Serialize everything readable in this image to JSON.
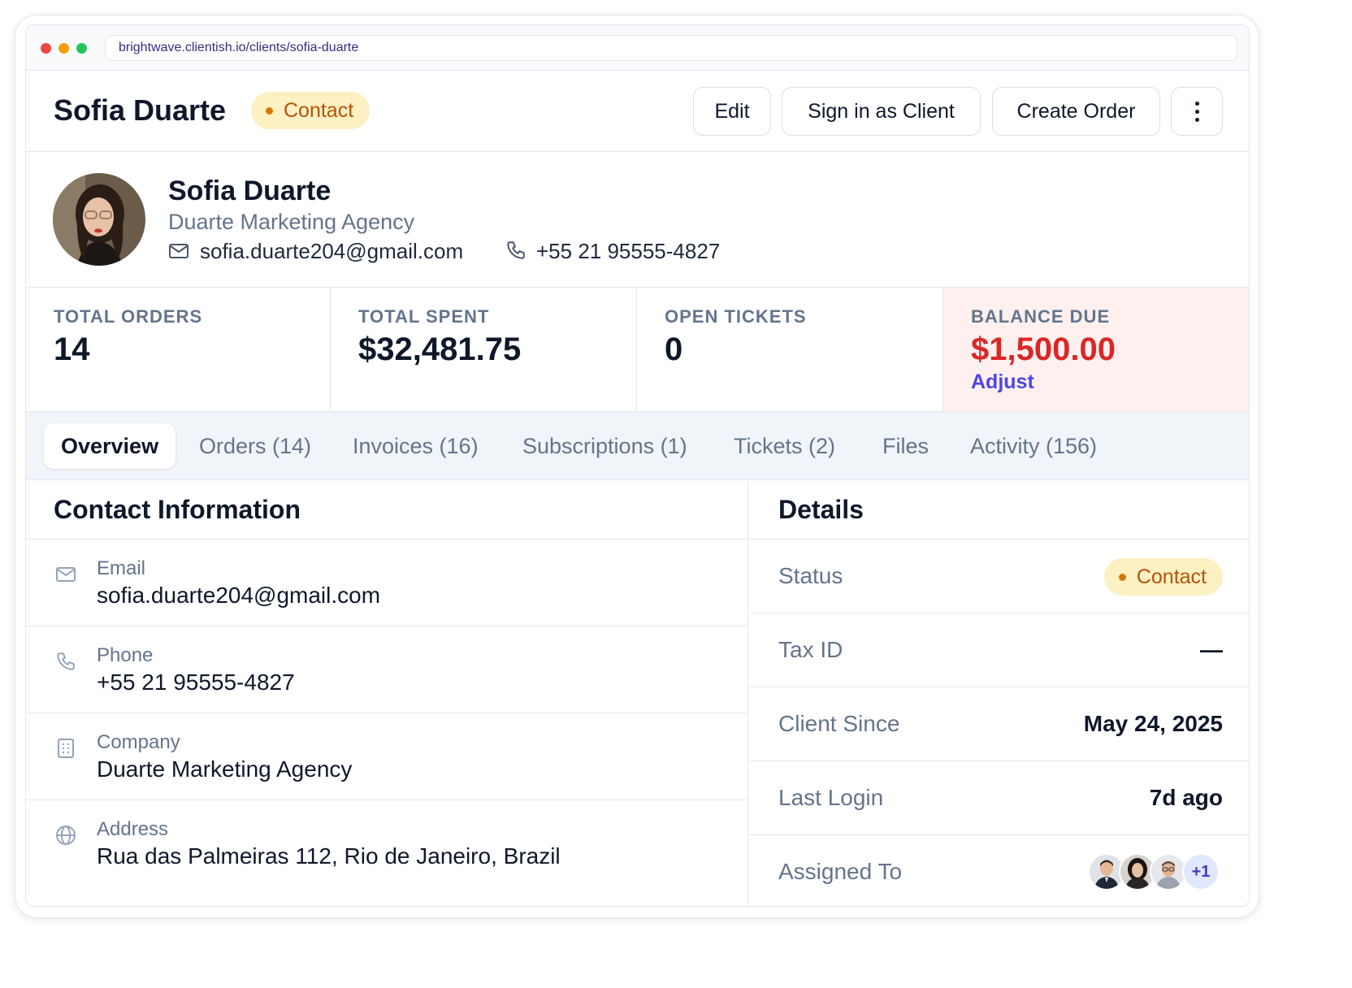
{
  "browser": {
    "url": "brightwave.clientish.io/clients/sofia-duarte"
  },
  "header": {
    "title": "Sofia Duarte",
    "status_badge": "Contact",
    "buttons": {
      "edit": "Edit",
      "sign_in": "Sign in as Client",
      "create_order": "Create Order"
    }
  },
  "profile": {
    "name": "Sofia Duarte",
    "company": "Duarte Marketing Agency",
    "email": "sofia.duarte204@gmail.com",
    "phone": "+55 21 95555-4827"
  },
  "stats": [
    {
      "label": "TOTAL ORDERS",
      "value": "14"
    },
    {
      "label": "TOTAL SPENT",
      "value": "$32,481.75"
    },
    {
      "label": "OPEN TICKETS",
      "value": "0"
    },
    {
      "label": "BALANCE DUE",
      "value": "$1,500.00",
      "link": "Adjust"
    }
  ],
  "tabs": [
    {
      "label": "Overview",
      "active": true
    },
    {
      "label": "Orders (14)"
    },
    {
      "label": "Invoices (16)"
    },
    {
      "label": "Subscriptions (1)"
    },
    {
      "label": "Tickets (2)"
    },
    {
      "label": "Files"
    },
    {
      "label": "Activity (156)"
    }
  ],
  "contact_info": {
    "title": "Contact Information",
    "rows": [
      {
        "label": "Email",
        "value": "sofia.duarte204@gmail.com",
        "icon": "mail-icon"
      },
      {
        "label": "Phone",
        "value": "+55 21 95555-4827",
        "icon": "phone-icon"
      },
      {
        "label": "Company",
        "value": "Duarte Marketing Agency",
        "icon": "building-icon"
      },
      {
        "label": "Address",
        "value": "Rua das Palmeiras 112, Rio de Janeiro, Brazil",
        "icon": "globe-icon"
      }
    ]
  },
  "details": {
    "title": "Details",
    "rows": [
      {
        "label": "Status",
        "badge": "Contact"
      },
      {
        "label": "Tax ID",
        "value": "—"
      },
      {
        "label": "Client Since",
        "value": "May 24, 2025"
      },
      {
        "label": "Last Login",
        "value": "7d ago"
      },
      {
        "label": "Assigned To",
        "more": "+1"
      }
    ]
  },
  "colors": {
    "accent": "#4f46e5",
    "badge_bg": "#fdf0c3",
    "badge_text": "#b45309",
    "balance_red": "#dc2626",
    "balance_bg": "#fdf0ef"
  }
}
